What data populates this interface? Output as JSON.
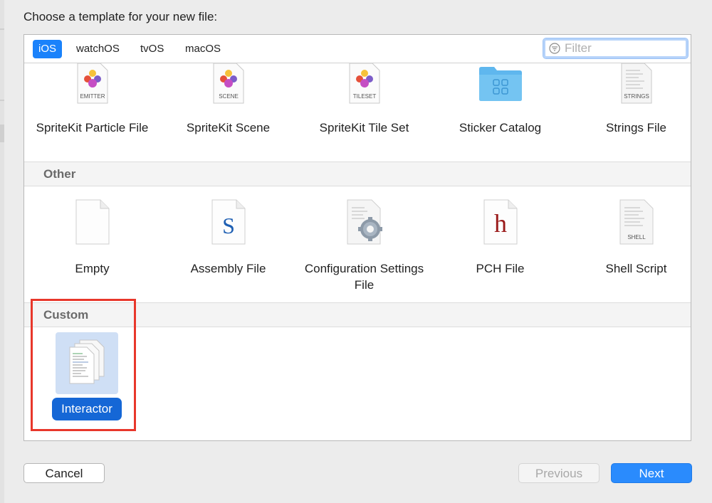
{
  "dialog": {
    "prompt": "Choose a template for your new file:"
  },
  "tabs": [
    {
      "label": "iOS",
      "active": true
    },
    {
      "label": "watchOS",
      "active": false
    },
    {
      "label": "tvOS",
      "active": false
    },
    {
      "label": "macOS",
      "active": false
    }
  ],
  "filter": {
    "placeholder": "Filter",
    "value": ""
  },
  "templates_top": [
    {
      "label": "SpriteKit Particle File",
      "icon": "spritekit-emitter-icon",
      "badge": "EMITTER"
    },
    {
      "label": "SpriteKit Scene",
      "icon": "spritekit-scene-icon",
      "badge": "SCENE"
    },
    {
      "label": "SpriteKit Tile Set",
      "icon": "spritekit-tileset-icon",
      "badge": "TILESET"
    },
    {
      "label": "Sticker Catalog",
      "icon": "folder-icon",
      "badge": ""
    },
    {
      "label": "Strings File",
      "icon": "strings-file-icon",
      "badge": "STRINGS"
    }
  ],
  "sections": {
    "other": "Other",
    "custom": "Custom"
  },
  "templates_other": [
    {
      "label": "Empty",
      "icon": "empty-file-icon",
      "badge": ""
    },
    {
      "label": "Assembly File",
      "icon": "assembly-file-icon",
      "badge": "S"
    },
    {
      "label": "Configuration Settings File",
      "icon": "config-settings-icon",
      "badge": ""
    },
    {
      "label": "PCH File",
      "icon": "pch-file-icon",
      "badge": "h"
    },
    {
      "label": "Shell Script",
      "icon": "shell-script-icon",
      "badge": "SHELL"
    }
  ],
  "templates_custom": [
    {
      "label": "Interactor",
      "icon": "interactor-template-icon",
      "selected": true
    }
  ],
  "buttons": {
    "cancel": "Cancel",
    "previous": "Previous",
    "next": "Next"
  },
  "colors": {
    "accent": "#1a82fb",
    "selection": "#1567d6",
    "highlight_box": "#e8372b"
  }
}
